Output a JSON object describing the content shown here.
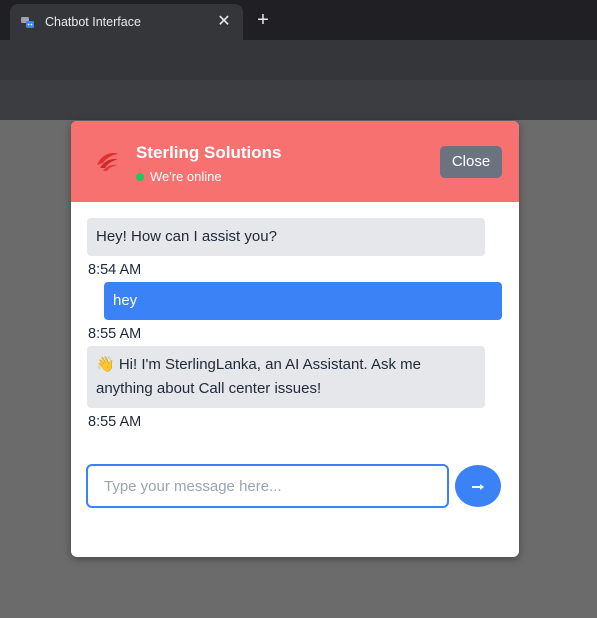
{
  "browser": {
    "tab_title": "Chatbot Interface",
    "tab_close": "✕",
    "new_tab": "+"
  },
  "chat": {
    "brand": "Sterling Solutions",
    "status": "We're online",
    "close_label": "Close",
    "messages": [
      {
        "sender": "bot",
        "text": "Hey! How can I assist you?",
        "time": "8:54 AM"
      },
      {
        "sender": "user",
        "text": "hey",
        "time": "8:55 AM"
      },
      {
        "sender": "bot",
        "text": "👋 Hi! I'm SterlingLanka, an AI Assistant. Ask me anything about Call center issues!",
        "time": "8:55 AM"
      }
    ],
    "input_placeholder": "Type your message here...",
    "input_value": ""
  },
  "colors": {
    "header": "#f87171",
    "user_bubble": "#3b82f6",
    "bot_bubble": "#e5e7eb",
    "online_dot": "#22c55e",
    "close_button": "#6b7280"
  },
  "icons": {
    "favicon": "chatbot-favicon-icon",
    "logo": "sterling-logo-icon",
    "send": "send-icon"
  }
}
